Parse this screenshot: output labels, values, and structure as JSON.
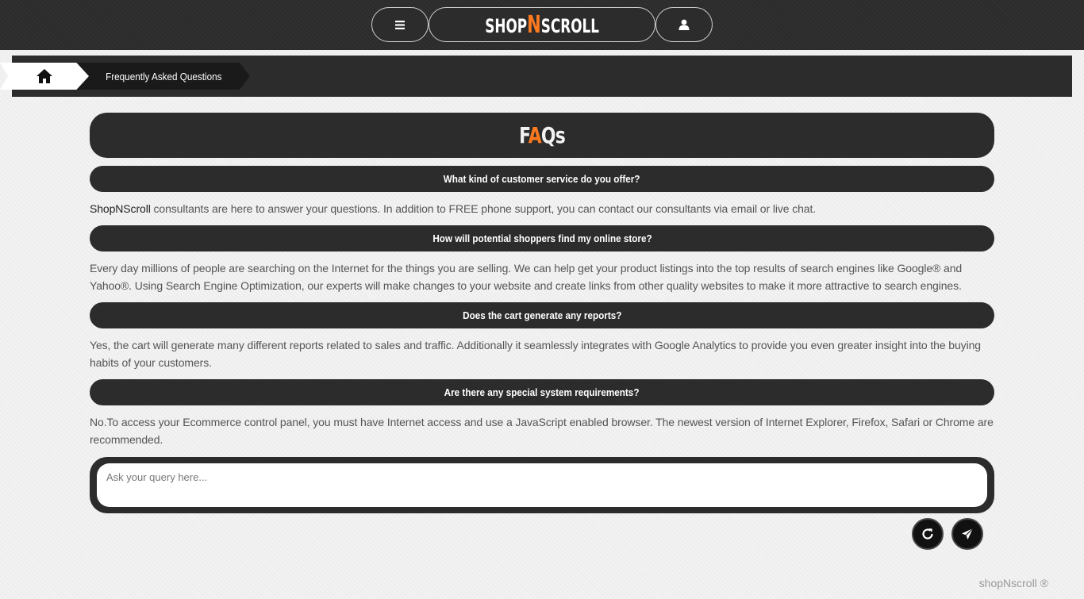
{
  "header": {
    "menu_icon": "hamburger-icon",
    "logo": {
      "part1": "SHOP",
      "accent": "N",
      "part2": "SCROLL"
    },
    "user_icon": "user-icon"
  },
  "breadcrumb": {
    "home_icon": "home-icon",
    "current": "Frequently Asked Questions"
  },
  "page": {
    "title": {
      "part1": "F",
      "accent": "A",
      "part2": "Qs"
    }
  },
  "faqs": [
    {
      "question": "What kind of customer service do you offer?",
      "answer_brand": "ShopNScroll",
      "answer": " consultants are here to answer your questions. In addition to FREE phone support, you can contact our consultants via email or live chat."
    },
    {
      "question": "How will potential shoppers find my online store?",
      "answer_brand": "",
      "answer": "Every day millions of people are searching on the Internet for the things you are selling. We can help get your product listings into the top results of search engines like Google® and Yahoo®. Using Search Engine Optimization, our experts will make changes to your website and create links from other quality websites to make it more attractive to search engines."
    },
    {
      "question": "Does the cart generate any reports?",
      "answer_brand": "",
      "answer": "Yes, the cart will generate many different reports related to sales and traffic. Additionally it seamlessly integrates with Google Analytics to provide you even greater insight into the buying habits of your customers."
    },
    {
      "question": "Are there any special system requirements?",
      "answer_brand": "",
      "answer": "No.To access your Ecommerce control panel, you must have Internet access and use a JavaScript enabled browser. The newest version of Internet Explorer, Firefox, Safari or Chrome are recommended."
    }
  ],
  "query": {
    "placeholder": "Ask your query here...",
    "value": "",
    "refresh_icon": "refresh-icon",
    "send_icon": "send-icon"
  },
  "footer": {
    "text": "shopNscroll ®"
  },
  "colors": {
    "dark": "#2c2c2c",
    "accent": "#ff7a1f",
    "background": "#f2f2f2"
  }
}
